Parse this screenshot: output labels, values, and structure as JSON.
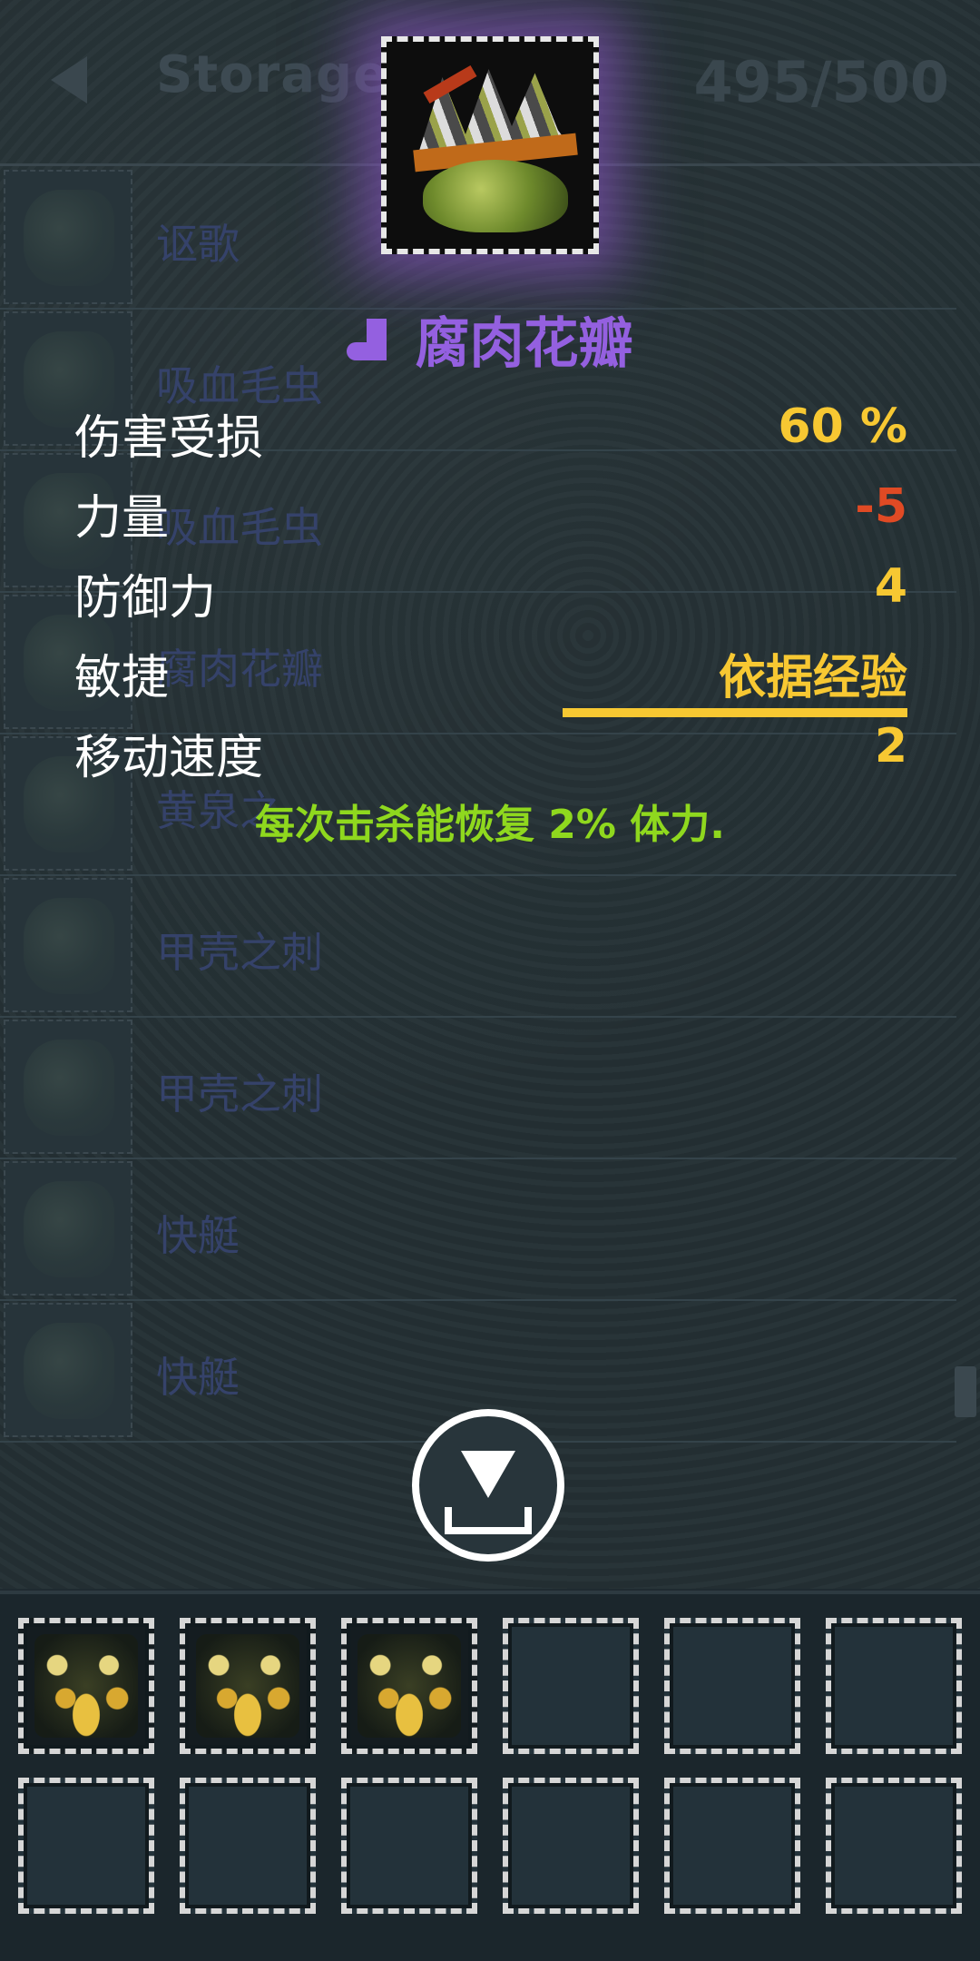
{
  "header": {
    "title": "Storage",
    "capacity": "495/500"
  },
  "storage_list": [
    {
      "label": "讴歌"
    },
    {
      "label": "吸血毛虫"
    },
    {
      "label": "吸血毛虫"
    },
    {
      "label": "腐肉花瓣"
    },
    {
      "label": "黄泉之"
    },
    {
      "label": "甲壳之刺"
    },
    {
      "label": "甲壳之刺"
    },
    {
      "label": "快艇"
    },
    {
      "label": "快艇"
    }
  ],
  "tooltip": {
    "item_name": "腐肉花瓣",
    "item_type_icon": "boot-icon",
    "rarity_color": "#9460e0",
    "stats": [
      {
        "label": "伤害受损",
        "value": "60 %"
      },
      {
        "label": "力量",
        "value": "-5"
      },
      {
        "label": "防御力",
        "value": "4"
      },
      {
        "label": "敏捷",
        "value": "依据经验"
      },
      {
        "label": "移动速度",
        "value": "2"
      }
    ],
    "effect": "每次击杀能恢复 2% 体力."
  },
  "actions": {
    "download_icon": "download-icon"
  },
  "inventory": {
    "slots": [
      {
        "item": "gold-pile-icon"
      },
      {
        "item": "gold-pile-icon"
      },
      {
        "item": "gold-pile-icon"
      },
      {
        "item": ""
      },
      {
        "item": ""
      },
      {
        "item": ""
      },
      {
        "item": ""
      },
      {
        "item": ""
      },
      {
        "item": ""
      },
      {
        "item": ""
      },
      {
        "item": ""
      },
      {
        "item": ""
      }
    ]
  },
  "colors": {
    "stat_value": "#f7c832",
    "stat_negative": "#e04a24",
    "effect_text": "#8fd81e"
  }
}
